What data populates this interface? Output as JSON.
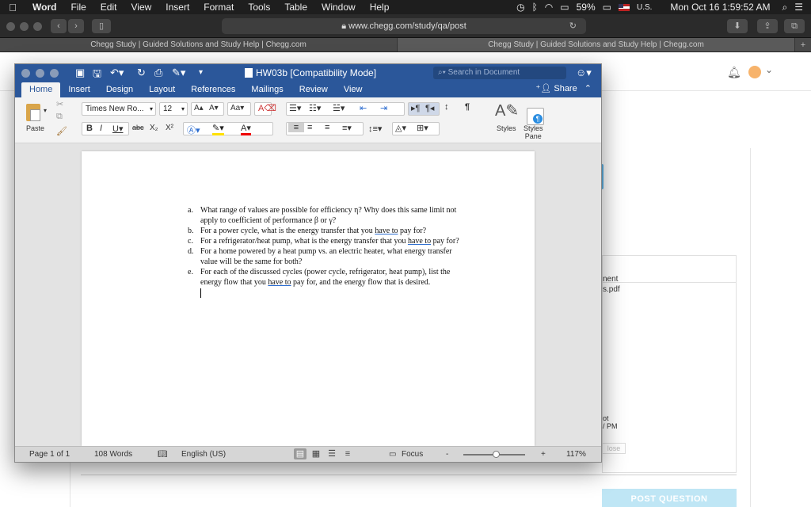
{
  "menubar": {
    "apple": "",
    "app_name": "Word",
    "items": [
      "File",
      "Edit",
      "View",
      "Insert",
      "Format",
      "Tools",
      "Table",
      "Window",
      "Help"
    ],
    "battery": "59%",
    "input_source": "U.S.",
    "datetime": "Mon Oct 16  1:59:52 AM"
  },
  "safari": {
    "url": "www.chegg.com/study/qa/post",
    "tabs": [
      "Chegg Study | Guided Solutions and Study Help | Chegg.com",
      "Chegg Study | Guided Solutions and Study Help | Chegg.com"
    ],
    "new_tab": "+"
  },
  "web": {
    "side_text_1": "nent",
    "side_text_2": "s.pdf",
    "side_text_3": "ot\n/ PM",
    "close_label": "lose",
    "post_question": "POST QUESTION"
  },
  "word": {
    "doc_title": "HW03b [Compatibility Mode]",
    "search_placeholder": "Search in Document",
    "tabs": [
      "Home",
      "Insert",
      "Design",
      "Layout",
      "References",
      "Mailings",
      "Review",
      "View"
    ],
    "active_tab": "Home",
    "share": "Share",
    "ribbon": {
      "paste": "Paste",
      "font_name": "Times New Ro...",
      "font_size": "12",
      "styles": "Styles",
      "styles_pane": "Styles\nPane"
    },
    "document": {
      "items": [
        {
          "letter": "a.",
          "parts": [
            {
              "t": "What range of values are possible for efficiency η?  Why does this same limit not apply to coefficient of performance β or γ?"
            }
          ]
        },
        {
          "letter": "b.",
          "parts": [
            {
              "t": "For a power cycle, what is the energy transfer that you "
            },
            {
              "t": "have to",
              "u": true
            },
            {
              "t": " pay for?"
            }
          ]
        },
        {
          "letter": "c.",
          "parts": [
            {
              "t": "For a refrigerator/heat pump, what is the energy transfer that you "
            },
            {
              "t": "have to",
              "u": true
            },
            {
              "t": " pay for?"
            }
          ]
        },
        {
          "letter": "d.",
          "parts": [
            {
              "t": "For a home powered by a heat pump vs. an electric heater, what energy transfer value will be the same for both?"
            }
          ]
        },
        {
          "letter": "e.",
          "parts": [
            {
              "t": "For each of the discussed cycles (power cycle, refrigerator, heat pump), list the energy flow that you "
            },
            {
              "t": "have to",
              "u": true
            },
            {
              "t": " pay for, and the energy flow that is desired."
            }
          ]
        }
      ]
    },
    "status": {
      "page": "Page 1 of 1",
      "words": "108 Words",
      "language": "English (US)",
      "focus": "Focus",
      "zoom_minus": "-",
      "zoom_plus": "+",
      "zoom": "117%"
    }
  }
}
